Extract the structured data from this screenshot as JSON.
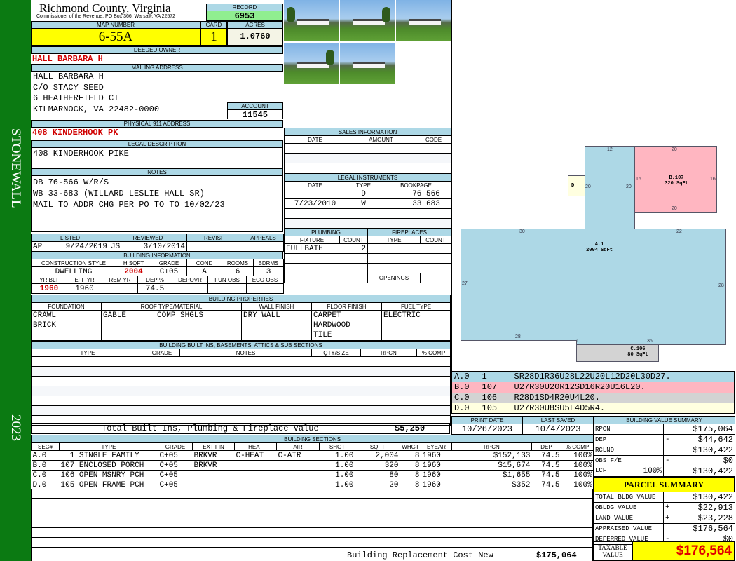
{
  "sidebar": {
    "district": "STONEWALL",
    "year": "2023"
  },
  "header": {
    "county": "Richmond County, Virginia",
    "subtitle": "Commissioner of the Revenue, PO Box 366, Warsaw, VA 22572",
    "record_label": "RECORD",
    "record": "6953"
  },
  "parcel": {
    "map_label": "MAP NUMBER",
    "map": "6-55A",
    "card_label": "CARD",
    "card": "1",
    "acres_label": "ACRES",
    "acres": "1.0760"
  },
  "owner": {
    "label": "DEEDED OWNER",
    "name": "HALL BARBARA H"
  },
  "mailing": {
    "label": "MAILING ADDRESS",
    "lines": [
      "HALL BARBARA H",
      "C/O STACY SEED",
      "6 HEATHERFIELD CT",
      "KILMARNOCK, VA 22482-0000"
    ],
    "account_label": "ACCOUNT",
    "account": "11545"
  },
  "physical": {
    "label": "PHYSICAL 911 ADDRESS",
    "value": "408 KINDERHOOK PK"
  },
  "legal": {
    "label": "LEGAL DESCRIPTION",
    "value": "408 KINDERHOOK PIKE"
  },
  "notes": {
    "label": "NOTES",
    "lines": [
      "DB 76-566 W/R/S",
      "WB 33-683 (WILLARD LESLIE HALL SR)",
      "MAIL TO ADDR CHG PER PO TO TO 10/02/23"
    ]
  },
  "listing": {
    "headers": [
      "LISTED",
      "REVIEWED",
      "REVISIT",
      "APPEALS"
    ],
    "listed_by": "AP",
    "listed": "9/24/2019",
    "reviewed_by": "JS",
    "reviewed": "3/10/2014"
  },
  "building_info": {
    "label": "BUILDING INFORMATION",
    "headers1": [
      "CONSTRUCTION STYLE",
      "H SQFT",
      "GRADE",
      "COND",
      "ROOMS",
      "BDRMS"
    ],
    "values1": [
      "DWELLING",
      "2004",
      "C+05",
      "A",
      "6",
      "3"
    ],
    "headers2": [
      "YR BLT",
      "EFF YR",
      "REM YR",
      "DEP %",
      "DEPOVR",
      "FUN OBS",
      "ECO OBS"
    ],
    "values2": [
      "1960",
      "1960",
      "",
      "74.5",
      "",
      "",
      ""
    ]
  },
  "sales": {
    "label": "SALES INFORMATION",
    "headers": [
      "DATE",
      "AMOUNT",
      "CODE"
    ]
  },
  "legal_instruments": {
    "label": "LEGAL INSTRUMENTS",
    "headers": [
      "DATE",
      "TYPE",
      "BOOKPAGE"
    ],
    "rows": [
      {
        "date": "",
        "type": "D",
        "book": "76",
        "page": "566"
      },
      {
        "date": "7/23/2010",
        "type": "W",
        "book": "33",
        "page": "683"
      }
    ]
  },
  "plumbing": {
    "label": "PLUMBING",
    "headers": [
      "FIXTURE",
      "COUNT"
    ],
    "fixture": "FULLBATH",
    "count": "2"
  },
  "fireplaces": {
    "label": "FIREPLACES",
    "headers": [
      "TYPE",
      "COUNT"
    ],
    "openings_label": "OPENINGS"
  },
  "properties": {
    "label": "BUILDING PROPERTIES",
    "headers": [
      "FOUNDATION",
      "ROOF TYPE/MATERIAL",
      "WALL FINISH",
      "FLOOR FINISH",
      "FUEL TYPE"
    ],
    "foundation": [
      "CRAWL",
      "BRICK"
    ],
    "roof_type": "GABLE",
    "roof_material": "COMP SHGLS",
    "wall": "DRY WALL",
    "floor": [
      "CARPET",
      "HARDWOOD",
      "TILE"
    ],
    "fuel": "ELECTRIC"
  },
  "builtins": {
    "label": "BUILDING BUILT INS, BASEMENTS, ATTICS & SUB SECTIONS",
    "headers": [
      "TYPE",
      "GRADE",
      "NOTES",
      "QTY/SIZE",
      "RPCN",
      "% COMP"
    ],
    "total_label": "Total Built Ins, Plumbing & Fireplace Value",
    "total": "$5,250"
  },
  "dates": {
    "print_label": "PRINT DATE",
    "print": "10/26/2023",
    "saved_label": "LAST SAVED",
    "saved": "10/4/2023"
  },
  "sections": {
    "label": "BUILDING SECTIONS",
    "headers": [
      "SEC#",
      "TYPE",
      "GRADE",
      "EXT FIN",
      "HEAT",
      "AIR",
      "SHGT",
      "SQFT",
      "WHGT",
      "EYEAR",
      "RPCN",
      "DEP",
      "% COMP"
    ],
    "rows": [
      [
        "A.0",
        "  1 SINGLE FAMILY",
        "C+05",
        "BRKVR",
        "C-HEAT",
        "C-AIR",
        "1.00",
        "2,004",
        "8",
        "1960",
        "$152,133",
        "74.5",
        "100%"
      ],
      [
        "B.0",
        "107 ENCLOSED PORCH",
        "C+05",
        "BRKVR",
        "",
        "",
        "1.00",
        "320",
        "8",
        "1960",
        "$15,674",
        "74.5",
        "100%"
      ],
      [
        "C.0",
        "106 OPEN MSNRY PCH",
        "C+05",
        "",
        "",
        "",
        "1.00",
        "80",
        "8",
        "1960",
        "$1,655",
        "74.5",
        "100%"
      ],
      [
        "D.0",
        "105 OPEN FRAME PCH",
        "C+05",
        "",
        "",
        "",
        "1.00",
        "20",
        "8",
        "1960",
        "$352",
        "74.5",
        "100%"
      ]
    ],
    "total_label": "Building Replacement Cost New",
    "total": "$175,064"
  },
  "sketch": {
    "a_label": "A.1",
    "a_area": "2004 SqFt",
    "b_label": "B.107",
    "b_area": "320 SqFt",
    "c_label": "C.106",
    "c_area": "80 SqFt",
    "d_label": "D",
    "dims": [
      "12",
      "20",
      "16",
      "16",
      "20",
      "20",
      "20",
      "30",
      "22",
      "27",
      "28",
      "28",
      "1",
      "36"
    ],
    "colors": {
      "A": "#add8e6",
      "B": "#ffb6c1",
      "C": "#d3d3d3",
      "D": "#ffffe0"
    },
    "codes": [
      {
        "sec": "A.0",
        "code": "1",
        "path": "SR28D1R36U28L22U20L12D20L30D27."
      },
      {
        "sec": "B.0",
        "code": "107",
        "path": "U27R30U20R12SD16R20U16L20."
      },
      {
        "sec": "C.0",
        "code": "106",
        "path": "R28D1SD4R20U4L20."
      },
      {
        "sec": "D.0",
        "code": "105",
        "path": "U27R30U8SU5L4D5R4."
      }
    ]
  },
  "value_summary": {
    "label": "BUILDING VALUE SUMMARY",
    "rows": [
      {
        "name": "RPCN",
        "sign": "",
        "value": "$175,064"
      },
      {
        "name": "DEP",
        "sign": "-",
        "value": "$44,642"
      },
      {
        "name": "RCLND",
        "sign": "",
        "value": "$130,422"
      },
      {
        "name": "OBS F/E",
        "sign": "-",
        "value": "$0"
      },
      {
        "name": "LCF",
        "pct": "100%",
        "sign": "",
        "value": "$130,422"
      }
    ]
  },
  "parcel_summary": {
    "label": "PARCEL SUMMARY",
    "rows": [
      {
        "name": "TOTAL BLDG VALUE",
        "sign": "",
        "value": "$130,422"
      },
      {
        "name": "OBLDG VALUE",
        "sign": "+",
        "value": "$22,913"
      },
      {
        "name": "LAND VALUE",
        "sign": "+",
        "value": "$23,228"
      },
      {
        "name": "APPRAISED VALUE",
        "sign": "",
        "value": "$176,564"
      },
      {
        "name": "DEFERRED VALUE",
        "sign": "-",
        "value": "$0"
      }
    ],
    "taxable_label": "TAXABLE VALUE",
    "taxable": "$176,564"
  }
}
